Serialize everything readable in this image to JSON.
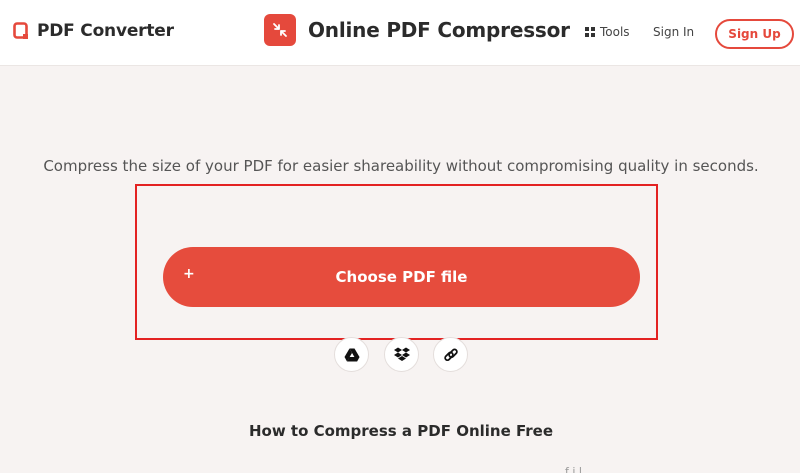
{
  "header": {
    "brand_name": "PDF Converter",
    "tool_title": "Online PDF Compressor",
    "nav": {
      "tools_label": "Tools",
      "signin_label": "Sign In",
      "signup_label": "Sign Up"
    }
  },
  "main": {
    "tagline": "Compress the size of your PDF for easier shareability without compromising quality in seconds.",
    "upload": {
      "plus_symbol": "+",
      "choose_label": "Choose PDF file",
      "sources": [
        "google-drive-icon",
        "dropbox-icon",
        "link-icon"
      ]
    },
    "how_to_heading": "How to Compress a PDF Online Free",
    "faint_text": "f      i          l"
  },
  "colors": {
    "accent": "#e5493c",
    "page_background": "#f7f3f2",
    "header_background": "#ffffff",
    "highlight_outline": "#e32222"
  }
}
